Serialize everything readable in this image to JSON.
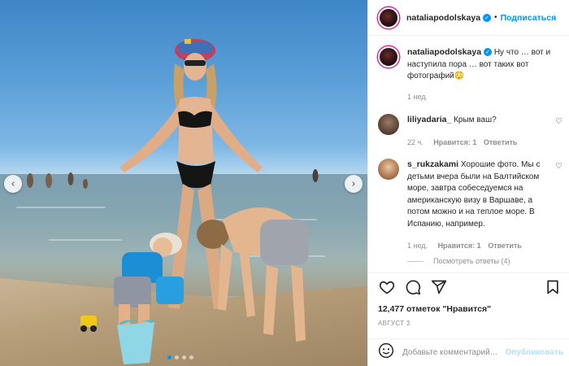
{
  "post": {
    "author": "nataliapodolskaya",
    "follow_label": "Подписаться",
    "follow_dot": "•",
    "caption": "Ну что … вот и наступила пора … вот таких вот фотографий😳",
    "caption_time": "1 нед.",
    "likes": "12,477 отметок \"Нравится\"",
    "date": "АВГУСТ 3",
    "carousel": {
      "slides": 4,
      "active_index": 0
    }
  },
  "comments": [
    {
      "username": "liliyadaria_",
      "text": "Крым ваш?",
      "time": "22 ч.",
      "likes": "Нравится: 1",
      "reply": "Ответить"
    },
    {
      "username": "s_rukzakami",
      "text": "Хорошие фото. Мы с детьми вчера были на Балтийском море, завтра собеседуемся на американскую визу в Варшаве, а потом можно и на теплое море. В Испанию, например.",
      "time": "1 нед.",
      "likes": "Нравится: 1",
      "reply": "Ответить",
      "view_replies": "Посмотреть ответы (4)"
    }
  ],
  "composer": {
    "placeholder": "Добавьте комментарий…",
    "post_label": "Опубликовать"
  },
  "icons": {
    "nav_prev": "chevron-left-icon",
    "nav_next": "chevron-right-icon",
    "verified": "verified-badge-icon",
    "like": "heart-icon",
    "comment": "comment-icon",
    "share": "share-icon",
    "save": "bookmark-icon",
    "emoji": "emoji-icon"
  },
  "colors": {
    "accent": "#0095f6",
    "muted": "#8e8e8e",
    "text": "#262626",
    "post_disabled": "#b2dffc"
  }
}
